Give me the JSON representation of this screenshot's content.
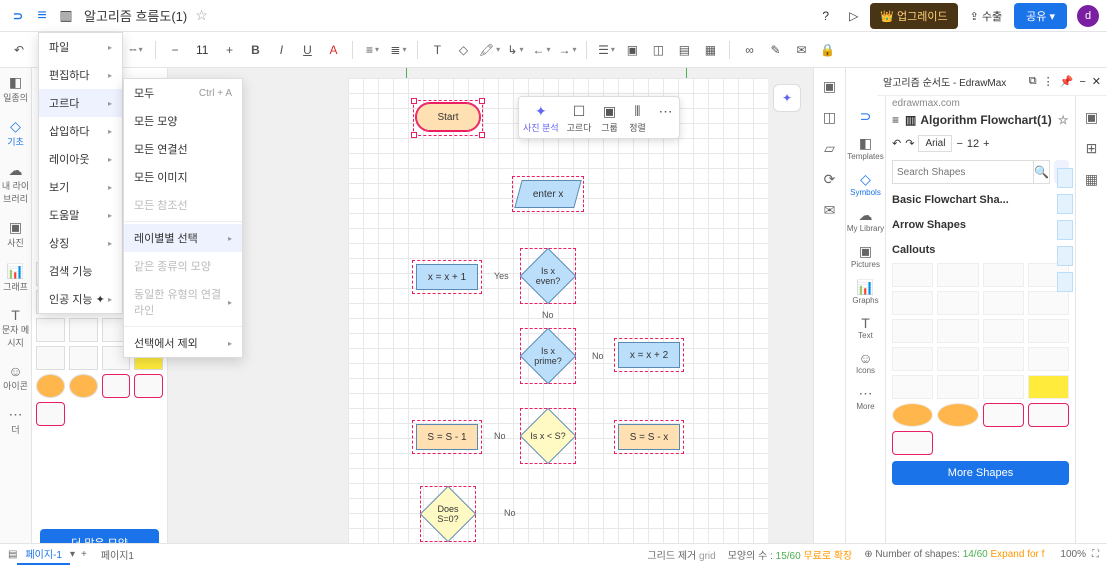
{
  "titlebar": {
    "doc_title": "알고리즘 흐름도(1)",
    "upgrade": "👑 업그레이드",
    "export": "⇪ 수출",
    "share": "공유 ▾",
    "avatar": "d"
  },
  "toolbar": {
    "font_size": "11"
  },
  "menu1": {
    "items": [
      {
        "label": "파일",
        "arrow": true
      },
      {
        "label": "편집하다",
        "arrow": true
      },
      {
        "label": "고르다",
        "arrow": true,
        "hov": true
      },
      {
        "label": "삽입하다",
        "arrow": true
      },
      {
        "label": "레이아웃",
        "arrow": true
      },
      {
        "label": "보기",
        "arrow": true
      },
      {
        "label": "도움말",
        "arrow": true
      },
      {
        "label": "상징",
        "arrow": true
      },
      {
        "label": "검색 기능"
      },
      {
        "label": "인공 지능 ✦",
        "arrow": true
      }
    ]
  },
  "menu2": {
    "items": [
      {
        "label": "모두",
        "shortcut": "Ctrl + A"
      },
      {
        "label": "모든 모양"
      },
      {
        "label": "모든 연결선"
      },
      {
        "label": "모든 이미지"
      },
      {
        "label": "모든 참조선",
        "disabled": true
      },
      {
        "label": "레이별별 선택",
        "arrow": true,
        "hov": true
      },
      {
        "label": "같은 종류의 모양",
        "disabled": true
      },
      {
        "label": "동일한 유형의 연결 라인",
        "disabled": true,
        "arrow": true
      },
      {
        "label": "선택에서 제외",
        "arrow": true
      }
    ]
  },
  "ctx": {
    "ai": "사진 분석",
    "sel": "고르다",
    "grp": "그룹",
    "align": "정렬"
  },
  "flowchart": {
    "start": "Start",
    "enter": "enter x",
    "even": "Is x even?",
    "xp1": "x = x + 1",
    "yes": "Yes",
    "no": "No",
    "prime": "Is x prime?",
    "xp2": "x = x + 2",
    "sm1": "S = S - 1",
    "xlts": "Is x < S?",
    "ssx": "S = S - x",
    "s0": "Does S=0?"
  },
  "left_shapes_more": "더 많은 모양",
  "leftrail": [
    "일종의",
    "기초",
    "내 라이브러리",
    "사진",
    "그래프",
    "문자 메시지",
    "아이콘",
    "더"
  ],
  "rightpanel": {
    "window_title": "알고리즘 순서도 - EdrawMax",
    "sub": "edrawmax.com",
    "doc": "Algorithm Flowchart(1)",
    "font": "Arial",
    "size": "12",
    "search_ph": "Search Shapes",
    "sec1": "Basic Flowchart Sha...",
    "sec2": "Arrow Shapes",
    "sec3": "Callouts",
    "more": "More Shapes",
    "rail": [
      "Templates",
      "Symbols",
      "My Library",
      "Pictures",
      "Graphs",
      "Text",
      "Icons",
      "More"
    ]
  },
  "status": {
    "page1": "페이지-1",
    "page2": "페이지1",
    "grid": "그리드 제거",
    "grid_en": "grid",
    "shapes": "모양의 수 :",
    "shapes_v": "15/60",
    "free": "무료로 확장",
    "shapes_en": "Number of shapes:",
    "shapes_en_v": "14/60",
    "expand": "Expand for f",
    "zoom": "100%"
  }
}
